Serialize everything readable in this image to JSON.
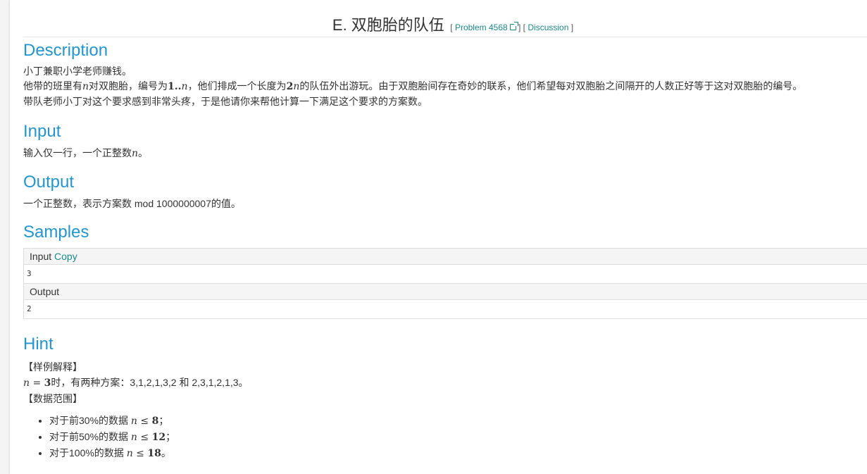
{
  "header": {
    "title": "E. 双胞胎的队伍",
    "open_bracket": "[",
    "problem_link": "Problem 4568",
    "mid_bracket": "] [",
    "discussion_link": "Discussion",
    "close_bracket": "]"
  },
  "description": {
    "heading": "Description",
    "line1": "小丁兼职小学老师赚钱。",
    "line2_a": "他带的班里有",
    "line2_n": "n",
    "line2_b": "对双胞胎，编号为",
    "line2_range_1": "1",
    "line2_range_dots": "..",
    "line2_range_n": "n",
    "line2_c": "，他们排成一个长度为",
    "line2_2n_2": "2",
    "line2_2n_n": "n",
    "line2_d": "的队伍外出游玩。由于双胞胎间存在奇妙的联系，他们希望每对双胞胎之间隔开的人数正好等于这对双胞胎的编号。",
    "line3": "带队老师小丁对这个要求感到非常头疼，于是他请你来帮他计算一下满足这个要求的方案数。"
  },
  "input": {
    "heading": "Input",
    "text_a": "输入仅一行，一个正整数",
    "text_n": "n",
    "text_b": "。"
  },
  "output": {
    "heading": "Output",
    "text": "一个正整数，表示方案数 mod 1000000007的值。"
  },
  "samples": {
    "heading": "Samples",
    "input_label": "Input",
    "copy_label": "Copy",
    "input_value": "3",
    "output_label": "Output",
    "output_value": "2"
  },
  "hint": {
    "heading": "Hint",
    "example_title": "【样例解释】",
    "example_n": "n",
    "example_eq": " = ",
    "example_3": "3",
    "example_text": "时，有两种方案：3,1,2,1,3,2 和 2,3,1,2,1,3。",
    "range_title": "【数据范围】",
    "ranges": [
      {
        "prefix": "对于前30%的数据 ",
        "n": "n",
        "le": " ≤ ",
        "val": "8",
        "suffix": "；"
      },
      {
        "prefix": "对于前50%的数据 ",
        "n": "n",
        "le": " ≤ ",
        "val": "12",
        "suffix": "；"
      },
      {
        "prefix": "对于100%的数据 ",
        "n": "n",
        "le": " ≤ ",
        "val": "18",
        "suffix": "。"
      }
    ]
  },
  "colors": {
    "heading": "#2196d3",
    "link": "#1a8a8a",
    "text": "#333333"
  }
}
